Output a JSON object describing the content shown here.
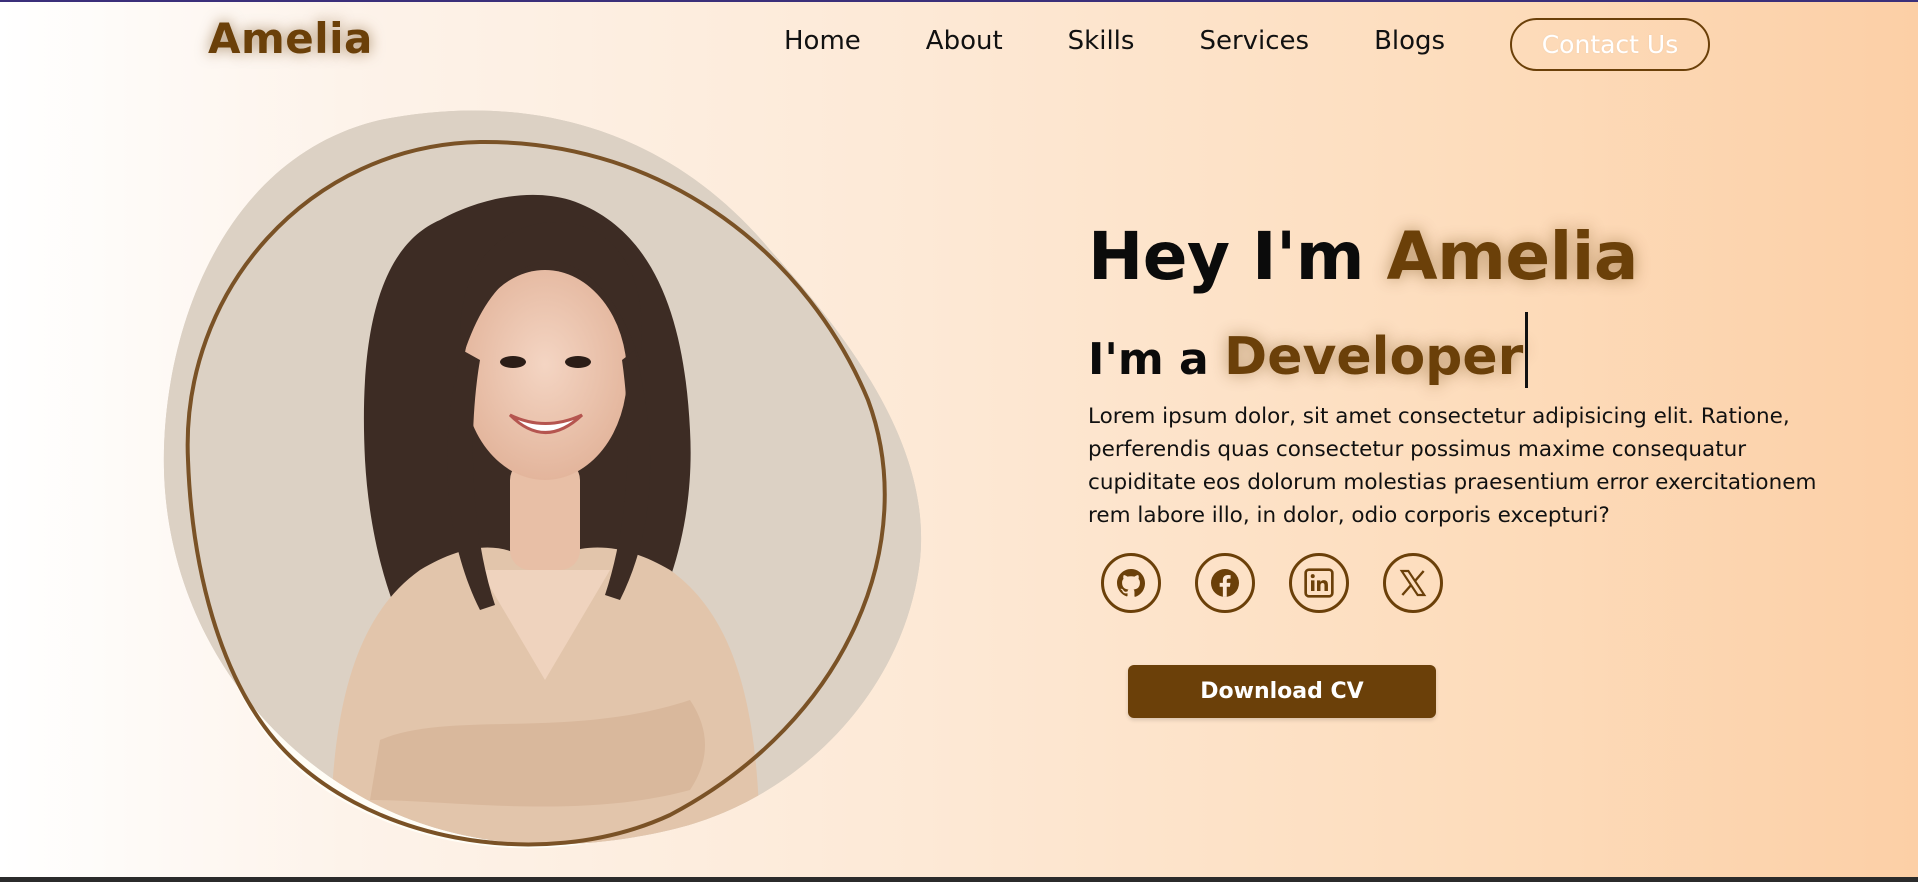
{
  "brand": {
    "logo": "Amelia"
  },
  "nav": {
    "items": [
      "Home",
      "About",
      "Skills",
      "Services",
      "Blogs"
    ],
    "contact_label": "Contact Us"
  },
  "hero": {
    "greeting": "Hey I'm ",
    "name": "Amelia",
    "role_prefix": "I'm a ",
    "role": "Developer",
    "description": "Lorem ipsum dolor, sit amet consectetur adipisicing elit. Ratione, perferendis quas consectetur possimus maxime consequatur cupiditate eos dolorum molestias praesentium error exercitationem rem labore illo, in dolor, odio corporis excepturi?",
    "download_label": "Download CV"
  },
  "socials": [
    "github-icon",
    "facebook-icon",
    "linkedin-icon",
    "x-icon"
  ],
  "colors": {
    "accent": "#6b4009",
    "text": "#0b0b0b",
    "bg_end": "#fccfa6"
  }
}
